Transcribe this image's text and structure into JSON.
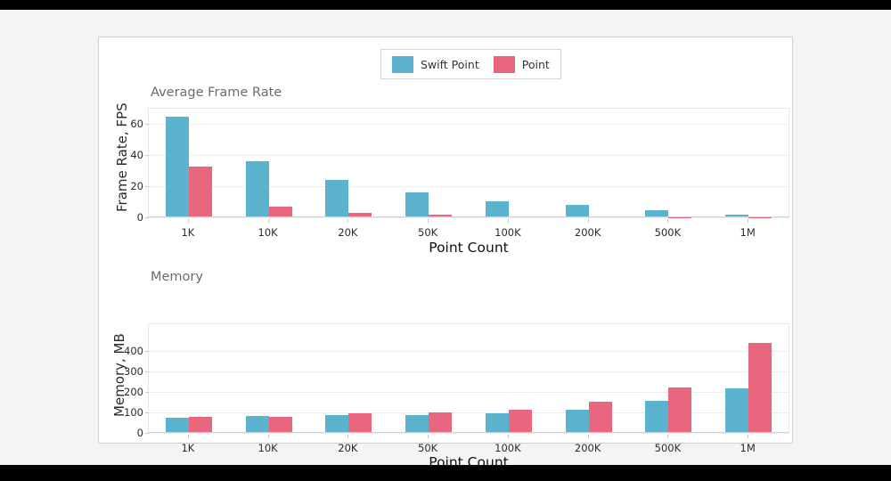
{
  "theme": {
    "page_background": "#f4f4f4",
    "card_background": "#ffffff",
    "series_colors": [
      "#5cb3cd",
      "#e8667e"
    ]
  },
  "legend": {
    "items": [
      {
        "label": "Swift Point",
        "color": "#5cb3cd"
      },
      {
        "label": "Point",
        "color": "#e8667e"
      }
    ]
  },
  "chart_data": [
    {
      "type": "bar",
      "title": "Average Frame Rate",
      "xlabel": "Point Count",
      "ylabel": "Frame Rate, FPS",
      "categories": [
        "1K",
        "10K",
        "20K",
        "50K",
        "100K",
        "200K",
        "500K",
        "1M"
      ],
      "yticks": [
        0,
        20,
        40,
        60
      ],
      "ylim": [
        0,
        70
      ],
      "grid": true,
      "legend_position": "top-center",
      "series": [
        {
          "name": "Swift Point",
          "color": "#5cb3cd",
          "values": [
            65,
            36,
            24,
            16,
            10.5,
            8,
            4.5,
            2
          ]
        },
        {
          "name": "Point",
          "color": "#e8667e",
          "values": [
            33,
            7,
            3,
            1.8,
            0.8,
            0.4,
            0.2,
            0.05
          ]
        }
      ]
    },
    {
      "type": "bar",
      "title": "Memory",
      "xlabel": "Point Count",
      "ylabel": "Memory, MB",
      "categories": [
        "1K",
        "10K",
        "20K",
        "50K",
        "100K",
        "200K",
        "500K",
        "1M"
      ],
      "yticks": [
        0,
        100,
        200,
        300,
        400
      ],
      "ylim": [
        0,
        530
      ],
      "grid": true,
      "legend_position": "top-center",
      "series": [
        {
          "name": "Swift Point",
          "color": "#5cb3cd",
          "values": [
            75,
            82,
            85,
            88,
            97,
            112,
            155,
            218
          ]
        },
        {
          "name": "Point",
          "color": "#e8667e",
          "values": [
            79,
            80,
            95,
            100,
            113,
            150,
            222,
            437
          ]
        }
      ]
    }
  ]
}
